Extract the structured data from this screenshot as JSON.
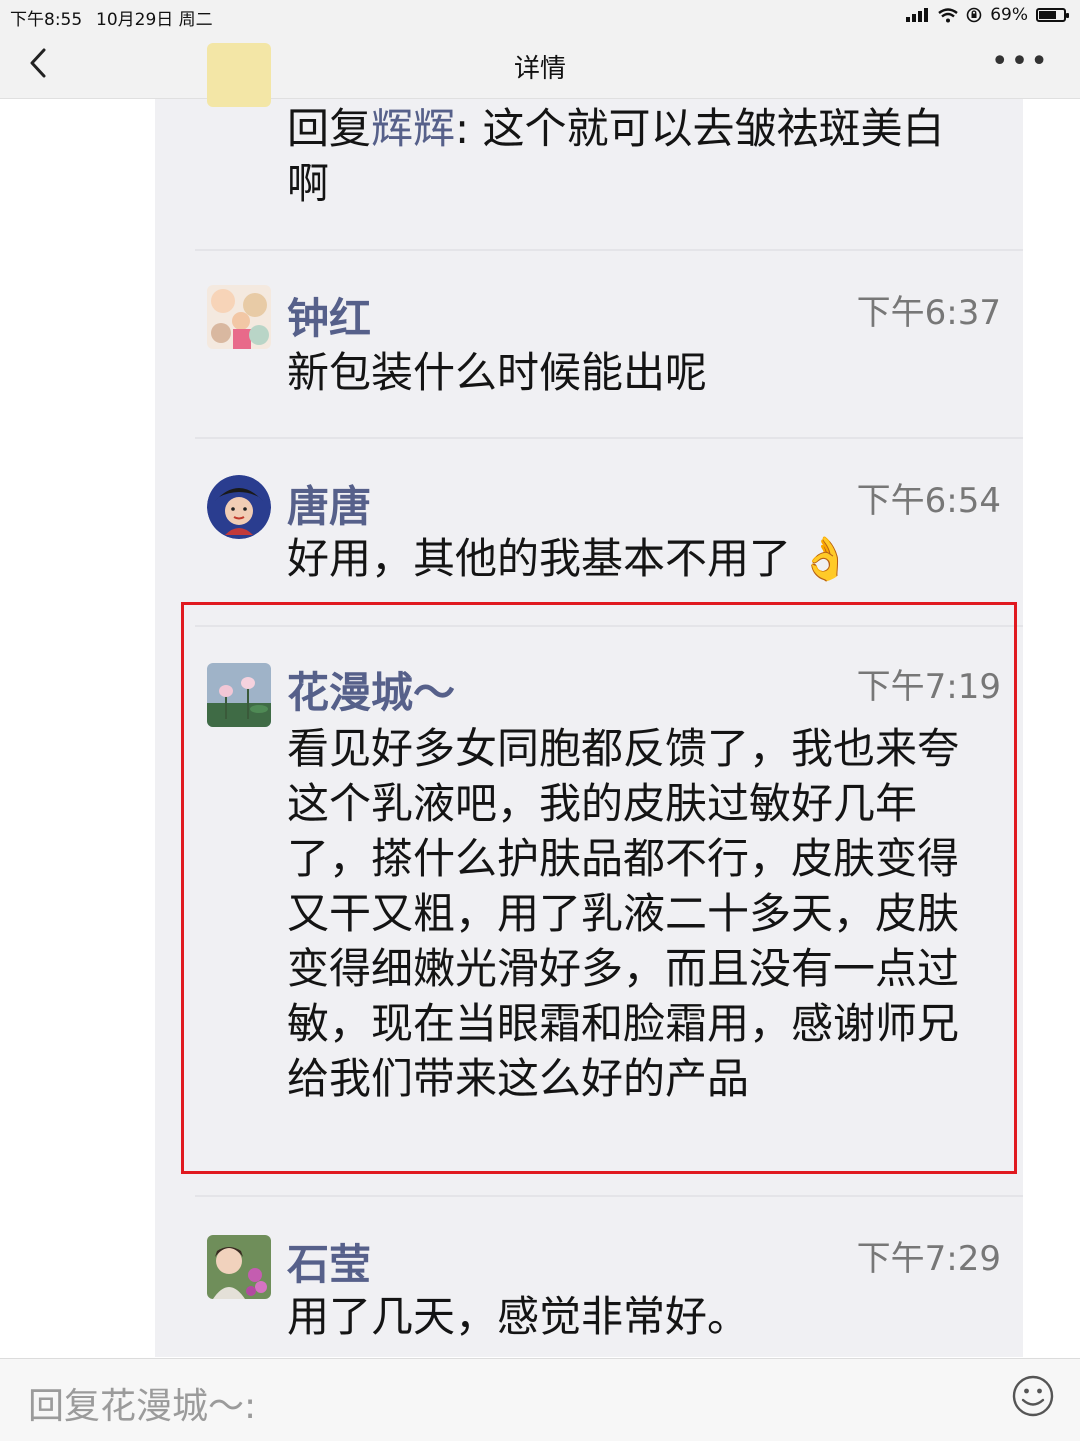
{
  "status_bar": {
    "time": "下午8:55",
    "date": "10月29日 周二",
    "battery": "69%",
    "battery_level": 0.69
  },
  "nav": {
    "title": "详情",
    "back_icon": "chevron-left-icon",
    "more_icon": "more-icon"
  },
  "comments": [
    {
      "reply_prefix": "回复",
      "reply_to": "辉辉",
      "reply_sep": ": ",
      "text": "这个就可以去皱祛斑美白啊"
    },
    {
      "name": "钟红",
      "time": "下午6:37",
      "text": "新包装什么时候能出呢"
    },
    {
      "name": "唐唐",
      "time": "下午6:54",
      "text": "好用，其他的我基本不用了",
      "emoji": "👌"
    },
    {
      "name": "花漫城～",
      "time": "下午7:19",
      "text": "看见好多女同胞都反馈了，我也来夸这个乳液吧，我的皮肤过敏好几年了，搽什么护肤品都不行，皮肤变得又干又粗，用了乳液二十多天，皮肤变得细嫩光滑好多，而且没有一点过敏，现在当眼霜和脸霜用，感谢师兄给我们带来这么好的产品"
    },
    {
      "name": "石莹",
      "time": "下午7:29",
      "text": "用了几天，感觉非常好。"
    }
  ],
  "input": {
    "placeholder": "回复花漫城～:",
    "emoji_icon": "smiley-icon"
  },
  "colors": {
    "name": "#56608a",
    "highlight_border": "#e0191f",
    "panel_bg": "#f0f0f3"
  }
}
